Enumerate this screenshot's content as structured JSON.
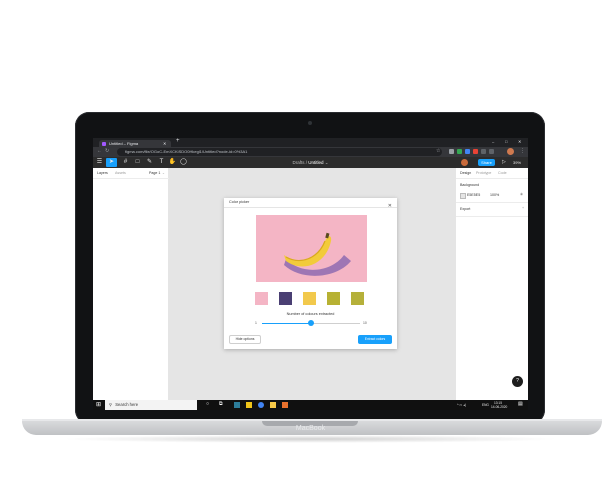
{
  "device": {
    "brand": "MacBook"
  },
  "browser": {
    "tab_title": "Untitled – Figma",
    "new_tab_symbol": "+",
    "url": "figma.com/file/OGoC-EmXCKiSDO0Hkegl1/Untitled?node-id=0%3A1",
    "window_controls": [
      "–",
      "□",
      "✕"
    ]
  },
  "figma": {
    "breadcrumb_prefix": "Drafts /",
    "file_name": "Untitled",
    "share_label": "Share",
    "zoom": "39%",
    "play_symbol": "▷",
    "left_tabs": [
      "Layers",
      "Assets"
    ],
    "page_label": "Page 1",
    "right_tabs": [
      "Design",
      "Prototype",
      "Code"
    ],
    "background_label": "Background",
    "background_hex": "E5E5E5",
    "background_opacity": "100%",
    "export_label": "Export",
    "help_symbol": "?"
  },
  "plugin": {
    "title": "Color picker",
    "close_symbol": "✕",
    "swatch_colors": [
      "#f4b5c5",
      "#4a3f73",
      "#f2c94c",
      "#b7b133",
      "#b5b03a"
    ],
    "slider_label": "Number of colours extracted",
    "slider_min": "1",
    "slider_max": "10",
    "slider_value_fraction": 0.5,
    "hide_button": "Hide options",
    "extract_button": "Extract colors"
  },
  "taskbar": {
    "search_placeholder": "Search here",
    "tray_lang": "ENG",
    "time": "13:15",
    "date": "14-06-2020"
  },
  "colors": {
    "accent": "#18a0fb",
    "canvas": "#e5e5e5",
    "toolbar": "#2c2c2c"
  }
}
